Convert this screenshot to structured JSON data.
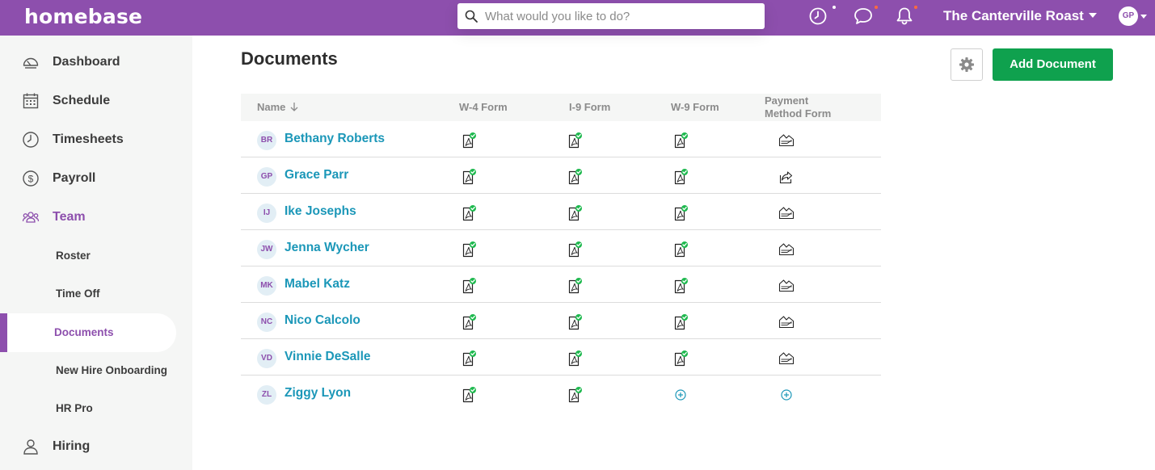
{
  "app": {
    "logo": "homebase"
  },
  "search": {
    "placeholder": "What would you like to do?"
  },
  "topbar": {
    "location": "The Canterville Roast",
    "user_initials": "GP",
    "icons": [
      "timeclock-icon",
      "chat-icon",
      "bell-icon"
    ]
  },
  "sidebar": {
    "items": [
      {
        "label": "Dashboard",
        "icon": "dashboard-icon"
      },
      {
        "label": "Schedule",
        "icon": "calendar-icon"
      },
      {
        "label": "Timesheets",
        "icon": "clock-icon"
      },
      {
        "label": "Payroll",
        "icon": "dollar-icon"
      },
      {
        "label": "Team",
        "icon": "team-icon",
        "active": true
      },
      {
        "label": "Hiring",
        "icon": "person-icon"
      }
    ],
    "team_sub": [
      {
        "label": "Roster"
      },
      {
        "label": "Time Off"
      },
      {
        "label": "Documents",
        "active": true
      },
      {
        "label": "New Hire Onboarding"
      },
      {
        "label": "HR Pro"
      }
    ]
  },
  "main": {
    "title": "Documents",
    "add_button": "Add Document",
    "table": {
      "headers": {
        "name": "Name",
        "w4": "W-4 Form",
        "i9": "I-9 Form",
        "w9": "W-9 Form",
        "payment_1": "Payment",
        "payment_2": "Method Form"
      },
      "rows": [
        {
          "initials": "BR",
          "name": "Bethany Roberts",
          "w4": "completed",
          "i9": "completed",
          "w9": "completed",
          "payment": "check"
        },
        {
          "initials": "GP",
          "name": "Grace Parr",
          "w4": "completed",
          "i9": "completed",
          "w9": "completed",
          "payment": "share"
        },
        {
          "initials": "IJ",
          "name": "Ike Josephs",
          "w4": "completed",
          "i9": "completed",
          "w9": "completed",
          "payment": "check"
        },
        {
          "initials": "JW",
          "name": "Jenna Wycher",
          "w4": "completed",
          "i9": "completed",
          "w9": "completed",
          "payment": "check"
        },
        {
          "initials": "MK",
          "name": "Mabel Katz",
          "w4": "completed",
          "i9": "completed",
          "w9": "completed",
          "payment": "check"
        },
        {
          "initials": "NC",
          "name": "Nico Calcolo",
          "w4": "completed",
          "i9": "completed",
          "w9": "completed",
          "payment": "check"
        },
        {
          "initials": "VD",
          "name": "Vinnie DeSalle",
          "w4": "completed",
          "i9": "completed",
          "w9": "completed",
          "payment": "check"
        },
        {
          "initials": "ZL",
          "name": "Ziggy Lyon",
          "w4": "completed",
          "i9": "completed",
          "w9": "add",
          "payment": "add"
        }
      ]
    }
  },
  "colors": {
    "brand": "#8d4fad",
    "primary_button": "#0fa14e",
    "link": "#1b97b8",
    "check": "#1fb94f"
  }
}
